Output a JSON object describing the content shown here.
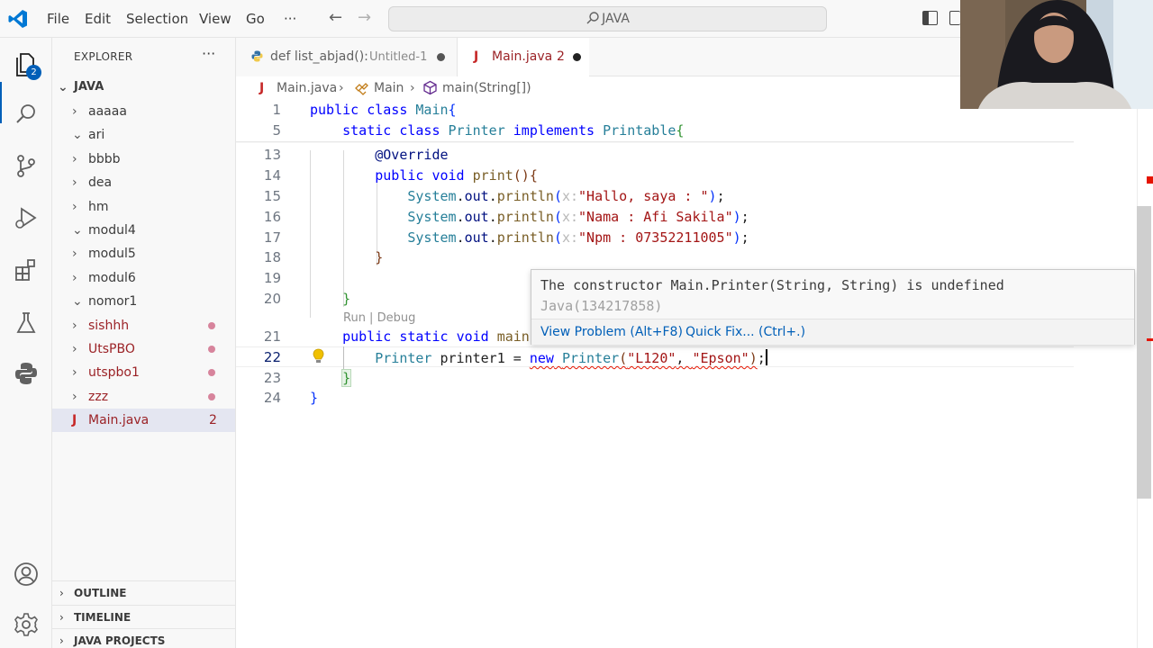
{
  "menu": {
    "file": "File",
    "edit": "Edit",
    "selection": "Selection",
    "view": "View",
    "go": "Go",
    "more": "···"
  },
  "command_center": {
    "label": "JAVA"
  },
  "activity": {
    "explorer_badge": "2"
  },
  "explorer": {
    "title": "EXPLORER",
    "more": "···",
    "root": "JAVA",
    "items": [
      {
        "label": "aaaaa",
        "chevron": "›",
        "dot": false,
        "selected": false
      },
      {
        "label": "ari",
        "chevron": "⌄",
        "dot": false,
        "selected": false
      },
      {
        "label": "bbbb",
        "chevron": "›",
        "dot": false,
        "selected": false
      },
      {
        "label": "dea",
        "chevron": "›",
        "dot": false,
        "selected": false
      },
      {
        "label": "hm",
        "chevron": "›",
        "dot": false,
        "selected": false
      },
      {
        "label": "modul4",
        "chevron": "⌄",
        "dot": false,
        "selected": false
      },
      {
        "label": "modul5",
        "chevron": "›",
        "dot": false,
        "selected": false
      },
      {
        "label": "modul6",
        "chevron": "›",
        "dot": false,
        "selected": false
      },
      {
        "label": "nomor1",
        "chevron": "⌄",
        "dot": false,
        "selected": false
      },
      {
        "label": "sishhh",
        "chevron": "›",
        "dot": true,
        "selected": false
      },
      {
        "label": "UtsPBO",
        "chevron": "›",
        "dot": true,
        "selected": false
      },
      {
        "label": "utspbo1",
        "chevron": "›",
        "dot": true,
        "selected": false
      },
      {
        "label": "zzz",
        "chevron": "›",
        "dot": true,
        "selected": false
      },
      {
        "label": "Main.java",
        "icon": "J",
        "count": "2",
        "selected": true
      }
    ],
    "sections": [
      "OUTLINE",
      "TIMELINE",
      "JAVA PROJECTS"
    ]
  },
  "tabs": {
    "inactive": {
      "label": "def list_abjad():",
      "desc": "Untitled-1"
    },
    "active": {
      "icon": "J",
      "label": "Main.java",
      "count": "2"
    }
  },
  "breadcrumb": {
    "file": "Main.java",
    "class": "Main",
    "method": "main(String[])"
  },
  "editor": {
    "line_numbers": [
      "1",
      "5",
      "13",
      "14",
      "15",
      "16",
      "17",
      "18",
      "19",
      "20",
      "21",
      "22",
      "23",
      "24"
    ],
    "codelens": "Run | Debug"
  },
  "hover": {
    "message": "The constructor Main.Printer(String, String) is undefined",
    "source": "Java(134217858)",
    "view_problem": "View Problem (Alt+F8)",
    "quick_fix": "Quick Fix... (Ctrl+.)"
  },
  "colors": {
    "accent": "#005fb8",
    "error": "#e51400",
    "java_red": "#9b2226",
    "modified_dot": "#d7849c"
  },
  "icons": [
    "vscode-logo-icon",
    "files-icon",
    "search-icon",
    "source-control-icon",
    "run-debug-icon",
    "extensions-icon",
    "testing-icon",
    "python-icon",
    "account-icon",
    "gear-icon",
    "lightbulb-icon"
  ]
}
